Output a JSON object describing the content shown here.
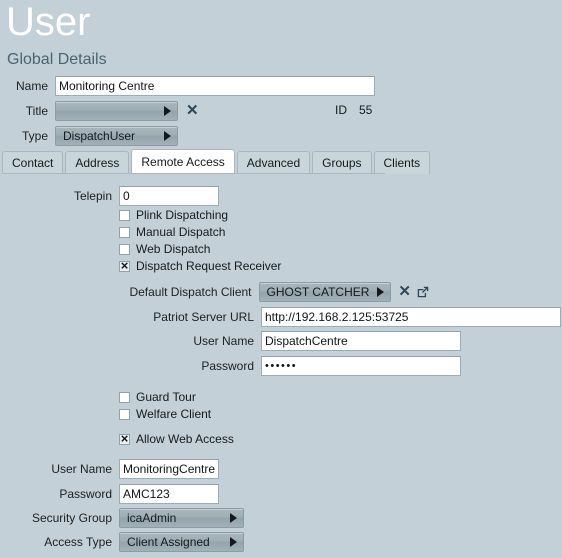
{
  "page": {
    "title": "User",
    "section_heading": "Global Details"
  },
  "global_details": {
    "name_label": "Name",
    "name_value": "Monitoring Centre",
    "title_label": "Title",
    "title_value": "",
    "title_clear_icon": "clear-x-icon",
    "type_label": "Type",
    "type_value": "DispatchUser",
    "id_label": "ID",
    "id_value": "55"
  },
  "tabs": [
    {
      "label": "Contact",
      "active": false
    },
    {
      "label": "Address",
      "active": false
    },
    {
      "label": "Remote Access",
      "active": true
    },
    {
      "label": "Advanced",
      "active": false
    },
    {
      "label": "Groups",
      "active": false
    },
    {
      "label": "Clients",
      "active": false
    }
  ],
  "remote_access": {
    "telepin_label": "Telepin",
    "telepin_value": "0",
    "checkboxes": [
      {
        "label": "Plink Dispatching",
        "checked": false
      },
      {
        "label": "Manual Dispatch",
        "checked": false
      },
      {
        "label": "Web Dispatch",
        "checked": false
      },
      {
        "label": "Dispatch Request Receiver",
        "checked": true
      }
    ],
    "default_dispatch_client_label": "Default Dispatch Client",
    "default_dispatch_client_value": "GHOST CATCHER",
    "default_dispatch_client_clear_icon": "clear-x-icon",
    "default_dispatch_client_open_icon": "external-link-icon",
    "patriot_url_label": "Patriot Server URL",
    "patriot_url_value": "http://192.168.2.125:53725",
    "dispatch_user_name_label": "User Name",
    "dispatch_user_name_value": "DispatchCentre",
    "dispatch_password_label": "Password",
    "dispatch_password_value": "••••••",
    "checkboxes2": [
      {
        "label": "Guard Tour",
        "checked": false
      },
      {
        "label": "Welfare Client",
        "checked": false
      }
    ],
    "allow_web_access_label": "Allow Web Access",
    "allow_web_access_checked": true,
    "web_user_name_label": "User Name",
    "web_user_name_value": "MonitoringCentre",
    "web_password_label": "Password",
    "web_password_value": "AMC123",
    "security_group_label": "Security Group",
    "security_group_value": "icaAdmin",
    "access_type_label": "Access Type",
    "access_type_value": "Client Assigned"
  },
  "colors": {
    "background": "#c3d0d7",
    "heading": "#4c6472",
    "title_text": "#ffffff",
    "combo": "#9fadb5",
    "icon": "#2d4757"
  }
}
